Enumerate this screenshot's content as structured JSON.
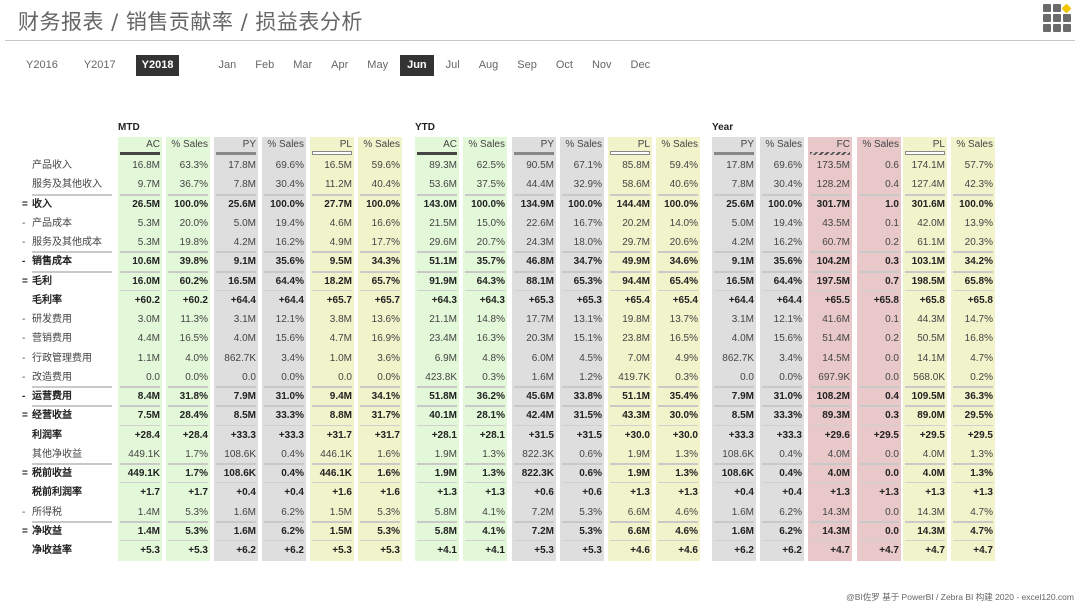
{
  "title": "财务报表 / 销售贡献率 / 损益表分析",
  "logo_icon": "app-grid-icon",
  "years": [
    {
      "label": "Y2016",
      "selected": false
    },
    {
      "label": "Y2017",
      "selected": false
    },
    {
      "label": "Y2018",
      "selected": true
    }
  ],
  "months": [
    {
      "label": "Jan",
      "selected": false
    },
    {
      "label": "Feb",
      "selected": false
    },
    {
      "label": "Mar",
      "selected": false
    },
    {
      "label": "Apr",
      "selected": false
    },
    {
      "label": "May",
      "selected": false
    },
    {
      "label": "Jun",
      "selected": true
    },
    {
      "label": "Jul",
      "selected": false
    },
    {
      "label": "Aug",
      "selected": false
    },
    {
      "label": "Sep",
      "selected": false
    },
    {
      "label": "Oct",
      "selected": false
    },
    {
      "label": "Nov",
      "selected": false
    },
    {
      "label": "Dec",
      "selected": false
    }
  ],
  "colors": {
    "ac_bg": "#e3f8d9",
    "py_bg": "#dedede",
    "pl_bg": "#f1f3cb",
    "fc_bg": "#e8c8c8",
    "selected_bg": "#333333"
  },
  "groups": [
    {
      "label": "MTD",
      "columns": [
        "AC",
        "% Sales",
        "PY",
        "% Sales",
        "PL",
        "% Sales"
      ],
      "kinds": [
        "ac",
        "ac",
        "py",
        "py",
        "pl",
        "pl"
      ]
    },
    {
      "label": "YTD",
      "columns": [
        "AC",
        "% Sales",
        "PY",
        "% Sales",
        "PL",
        "% Sales"
      ],
      "kinds": [
        "ac",
        "ac",
        "py",
        "py",
        "pl",
        "pl"
      ]
    },
    {
      "label": "Year",
      "columns": [
        "PY",
        "% Sales",
        "FC",
        "% Sales",
        "PL",
        "% Sales"
      ],
      "kinds": [
        "py",
        "py",
        "fc",
        "fc",
        "pl",
        "pl"
      ]
    }
  ],
  "rows": [
    {
      "op": "",
      "label": "产品收入",
      "style": "normal",
      "values": [
        "16.8M",
        "63.3%",
        "17.8M",
        "69.6%",
        "16.5M",
        "59.6%",
        "89.3M",
        "62.5%",
        "90.5M",
        "67.1%",
        "85.8M",
        "59.4%",
        "17.8M",
        "69.6%",
        "173.5M",
        "0.6",
        "174.1M",
        "57.7%"
      ]
    },
    {
      "op": "",
      "label": "服务及其他收入",
      "style": "normal",
      "values": [
        "9.7M",
        "36.7%",
        "7.8M",
        "30.4%",
        "11.2M",
        "40.4%",
        "53.6M",
        "37.5%",
        "44.4M",
        "32.9%",
        "58.6M",
        "40.6%",
        "7.8M",
        "30.4%",
        "128.2M",
        "0.4",
        "127.4M",
        "42.3%"
      ]
    },
    {
      "op": "=",
      "label": "收入",
      "style": "total",
      "values": [
        "26.5M",
        "100.0%",
        "25.6M",
        "100.0%",
        "27.7M",
        "100.0%",
        "143.0M",
        "100.0%",
        "134.9M",
        "100.0%",
        "144.4M",
        "100.0%",
        "25.6M",
        "100.0%",
        "301.7M",
        "1.0",
        "301.6M",
        "100.0%"
      ]
    },
    {
      "op": "-",
      "label": "产品成本",
      "style": "normal",
      "values": [
        "5.3M",
        "20.0%",
        "5.0M",
        "19.4%",
        "4.6M",
        "16.6%",
        "21.5M",
        "15.0%",
        "22.6M",
        "16.7%",
        "20.2M",
        "14.0%",
        "5.0M",
        "19.4%",
        "43.5M",
        "0.1",
        "42.0M",
        "13.9%"
      ]
    },
    {
      "op": "-",
      "label": "服务及其他成本",
      "style": "normal",
      "values": [
        "5.3M",
        "19.8%",
        "4.2M",
        "16.2%",
        "4.9M",
        "17.7%",
        "29.6M",
        "20.7%",
        "24.3M",
        "18.0%",
        "29.7M",
        "20.6%",
        "4.2M",
        "16.2%",
        "60.7M",
        "0.2",
        "61.1M",
        "20.3%"
      ]
    },
    {
      "op": "-",
      "label": "销售成本",
      "style": "total",
      "values": [
        "10.6M",
        "39.8%",
        "9.1M",
        "35.6%",
        "9.5M",
        "34.3%",
        "51.1M",
        "35.7%",
        "46.8M",
        "34.7%",
        "49.9M",
        "34.6%",
        "9.1M",
        "35.6%",
        "104.2M",
        "0.3",
        "103.1M",
        "34.2%"
      ]
    },
    {
      "op": "=",
      "label": "毛利",
      "style": "total",
      "values": [
        "16.0M",
        "60.2%",
        "16.5M",
        "64.4%",
        "18.2M",
        "65.7%",
        "91.9M",
        "64.3%",
        "88.1M",
        "65.3%",
        "94.4M",
        "65.4%",
        "16.5M",
        "64.4%",
        "197.5M",
        "0.7",
        "198.5M",
        "65.8%"
      ]
    },
    {
      "op": "",
      "label": "毛利率",
      "style": "ratio",
      "values": [
        "+60.2",
        "+60.2",
        "+64.4",
        "+64.4",
        "+65.7",
        "+65.7",
        "+64.3",
        "+64.3",
        "+65.3",
        "+65.3",
        "+65.4",
        "+65.4",
        "+64.4",
        "+64.4",
        "+65.5",
        "+65.8",
        "+65.8",
        "+65.8"
      ]
    },
    {
      "op": "-",
      "label": "研发费用",
      "style": "normal",
      "values": [
        "3.0M",
        "11.3%",
        "3.1M",
        "12.1%",
        "3.8M",
        "13.6%",
        "21.1M",
        "14.8%",
        "17.7M",
        "13.1%",
        "19.8M",
        "13.7%",
        "3.1M",
        "12.1%",
        "41.6M",
        "0.1",
        "44.3M",
        "14.7%"
      ]
    },
    {
      "op": "-",
      "label": "营销费用",
      "style": "normal",
      "values": [
        "4.4M",
        "16.5%",
        "4.0M",
        "15.6%",
        "4.7M",
        "16.9%",
        "23.4M",
        "16.3%",
        "20.3M",
        "15.1%",
        "23.8M",
        "16.5%",
        "4.0M",
        "15.6%",
        "51.4M",
        "0.2",
        "50.5M",
        "16.8%"
      ]
    },
    {
      "op": "-",
      "label": "行政管理费用",
      "style": "normal",
      "values": [
        "1.1M",
        "4.0%",
        "862.7K",
        "3.4%",
        "1.0M",
        "3.6%",
        "6.9M",
        "4.8%",
        "6.0M",
        "4.5%",
        "7.0M",
        "4.9%",
        "862.7K",
        "3.4%",
        "14.5M",
        "0.0",
        "14.1M",
        "4.7%"
      ]
    },
    {
      "op": "-",
      "label": "改造费用",
      "style": "normal",
      "values": [
        "0.0",
        "0.0%",
        "0.0",
        "0.0%",
        "0.0",
        "0.0%",
        "423.8K",
        "0.3%",
        "1.6M",
        "1.2%",
        "419.7K",
        "0.3%",
        "0.0",
        "0.0%",
        "697.9K",
        "0.0",
        "568.0K",
        "0.2%"
      ]
    },
    {
      "op": "-",
      "label": "运营费用",
      "style": "total",
      "values": [
        "8.4M",
        "31.8%",
        "7.9M",
        "31.0%",
        "9.4M",
        "34.1%",
        "51.8M",
        "36.2%",
        "45.6M",
        "33.8%",
        "51.1M",
        "35.4%",
        "7.9M",
        "31.0%",
        "108.2M",
        "0.4",
        "109.5M",
        "36.3%"
      ]
    },
    {
      "op": "=",
      "label": "经营收益",
      "style": "total",
      "values": [
        "7.5M",
        "28.4%",
        "8.5M",
        "33.3%",
        "8.8M",
        "31.7%",
        "40.1M",
        "28.1%",
        "42.4M",
        "31.5%",
        "43.3M",
        "30.0%",
        "8.5M",
        "33.3%",
        "89.3M",
        "0.3",
        "89.0M",
        "29.5%"
      ]
    },
    {
      "op": "",
      "label": "利润率",
      "style": "ratio",
      "values": [
        "+28.4",
        "+28.4",
        "+33.3",
        "+33.3",
        "+31.7",
        "+31.7",
        "+28.1",
        "+28.1",
        "+31.5",
        "+31.5",
        "+30.0",
        "+30.0",
        "+33.3",
        "+33.3",
        "+29.6",
        "+29.5",
        "+29.5",
        "+29.5"
      ]
    },
    {
      "op": "",
      "label": "其他净收益",
      "style": "normal",
      "values": [
        "449.1K",
        "1.7%",
        "108.6K",
        "0.4%",
        "446.1K",
        "1.6%",
        "1.9M",
        "1.3%",
        "822.3K",
        "0.6%",
        "1.9M",
        "1.3%",
        "108.6K",
        "0.4%",
        "4.0M",
        "0.0",
        "4.0M",
        "1.3%"
      ]
    },
    {
      "op": "=",
      "label": "税前收益",
      "style": "total",
      "values": [
        "449.1K",
        "1.7%",
        "108.6K",
        "0.4%",
        "446.1K",
        "1.6%",
        "1.9M",
        "1.3%",
        "822.3K",
        "0.6%",
        "1.9M",
        "1.3%",
        "108.6K",
        "0.4%",
        "4.0M",
        "0.0",
        "4.0M",
        "1.3%"
      ]
    },
    {
      "op": "",
      "label": "税前利润率",
      "style": "ratio",
      "values": [
        "+1.7",
        "+1.7",
        "+0.4",
        "+0.4",
        "+1.6",
        "+1.6",
        "+1.3",
        "+1.3",
        "+0.6",
        "+0.6",
        "+1.3",
        "+1.3",
        "+0.4",
        "+0.4",
        "+1.3",
        "+1.3",
        "+1.3",
        "+1.3"
      ]
    },
    {
      "op": "-",
      "label": "所得税",
      "style": "normal",
      "values": [
        "1.4M",
        "5.3%",
        "1.6M",
        "6.2%",
        "1.5M",
        "5.3%",
        "5.8M",
        "4.1%",
        "7.2M",
        "5.3%",
        "6.6M",
        "4.6%",
        "1.6M",
        "6.2%",
        "14.3M",
        "0.0",
        "14.3M",
        "4.7%"
      ]
    },
    {
      "op": "=",
      "label": "净收益",
      "style": "total",
      "values": [
        "1.4M",
        "5.3%",
        "1.6M",
        "6.2%",
        "1.5M",
        "5.3%",
        "5.8M",
        "4.1%",
        "7.2M",
        "5.3%",
        "6.6M",
        "4.6%",
        "1.6M",
        "6.2%",
        "14.3M",
        "0.0",
        "14.3M",
        "4.7%"
      ]
    },
    {
      "op": "",
      "label": "净收益率",
      "style": "ratio",
      "values": [
        "+5.3",
        "+5.3",
        "+6.2",
        "+6.2",
        "+5.3",
        "+5.3",
        "+4.1",
        "+4.1",
        "+5.3",
        "+5.3",
        "+4.6",
        "+4.6",
        "+6.2",
        "+6.2",
        "+4.7",
        "+4.7",
        "+4.7",
        "+4.7"
      ]
    }
  ],
  "footer": "@BI佐罗   基于 PowerBI / Zebra BI 构建 2020 - excel120.com"
}
